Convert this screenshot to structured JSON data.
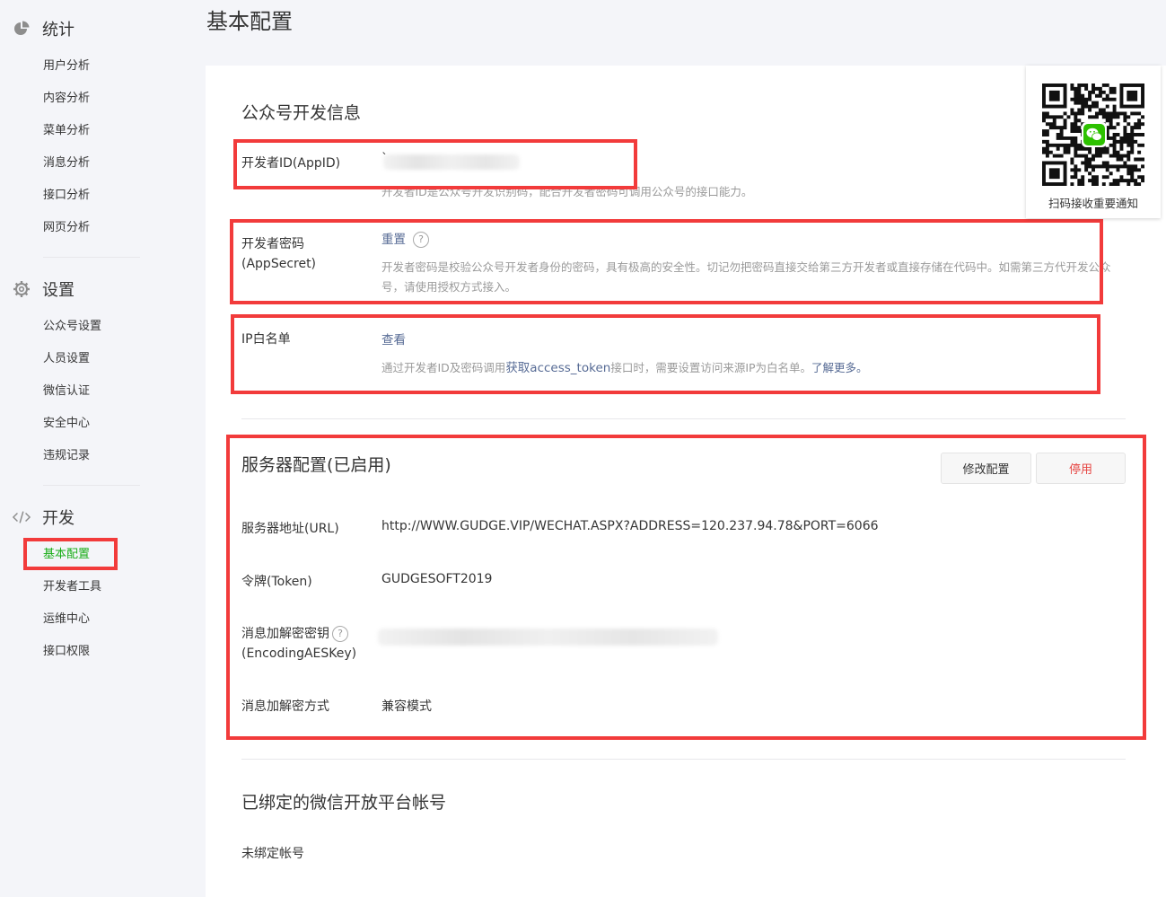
{
  "sidebar": {
    "stats": {
      "title": "统计",
      "icon": "pie-chart-icon",
      "items": [
        "用户分析",
        "内容分析",
        "菜单分析",
        "消息分析",
        "接口分析",
        "网页分析"
      ]
    },
    "settings": {
      "title": "设置",
      "icon": "gear-icon",
      "items": [
        "公众号设置",
        "人员设置",
        "微信认证",
        "安全中心",
        "违规记录"
      ]
    },
    "develop": {
      "title": "开发",
      "icon": "code-icon",
      "items": [
        "基本配置",
        "开发者工具",
        "运维中心",
        "接口权限"
      ],
      "active": "基本配置"
    }
  },
  "page": {
    "title": "基本配置"
  },
  "dev_info": {
    "title": "公众号开发信息",
    "appid": {
      "label": "开发者ID(AppID)",
      "value": "`",
      "desc": "开发者ID是公众号开发识别码，配合开发者密码可调用公众号的接口能力。"
    },
    "secret": {
      "label_line1": "开发者密码",
      "label_line2": "(AppSecret)",
      "action": "重置",
      "help": "?",
      "desc": "开发者密码是校验公众号开发者身份的密码，具有极高的安全性。切记勿把密码直接交给第三方开发者或直接存储在代码中。如需第三方代开发公众号，请使用授权方式接入。"
    },
    "ip": {
      "label": "IP白名单",
      "action": "查看",
      "desc_prefix": "通过开发者ID及密码调用",
      "desc_link": "获取access_token",
      "desc_middle": "接口时，需要设置访问来源IP为白名单。",
      "desc_more": "了解更多。"
    }
  },
  "server": {
    "title": "服务器配置(已启用)",
    "modify_btn": "修改配置",
    "disable_btn": "停用",
    "url_label": "服务器地址(URL)",
    "url_value": "http://WWW.GUDGE.VIP/WECHAT.ASPX?ADDRESS=120.237.94.78&PORT=6066",
    "token_label": "令牌(Token)",
    "token_value": "GUDGESOFT2019",
    "aes_label_line1": "消息加解密密钥",
    "aes_label_line2": "(EncodingAESKey)",
    "aes_help": "?",
    "mode_label": "消息加解密方式",
    "mode_value": "兼容模式"
  },
  "bound": {
    "title": "已绑定的微信开放平台帐号",
    "value": "未绑定帐号"
  },
  "qr": {
    "caption": "扫码接收重要通知",
    "icon": "wechat-icon"
  },
  "colors": {
    "accent": "#1aad19",
    "link": "#576b95",
    "annotation": "#f23b3b",
    "danger": "#e64340"
  }
}
